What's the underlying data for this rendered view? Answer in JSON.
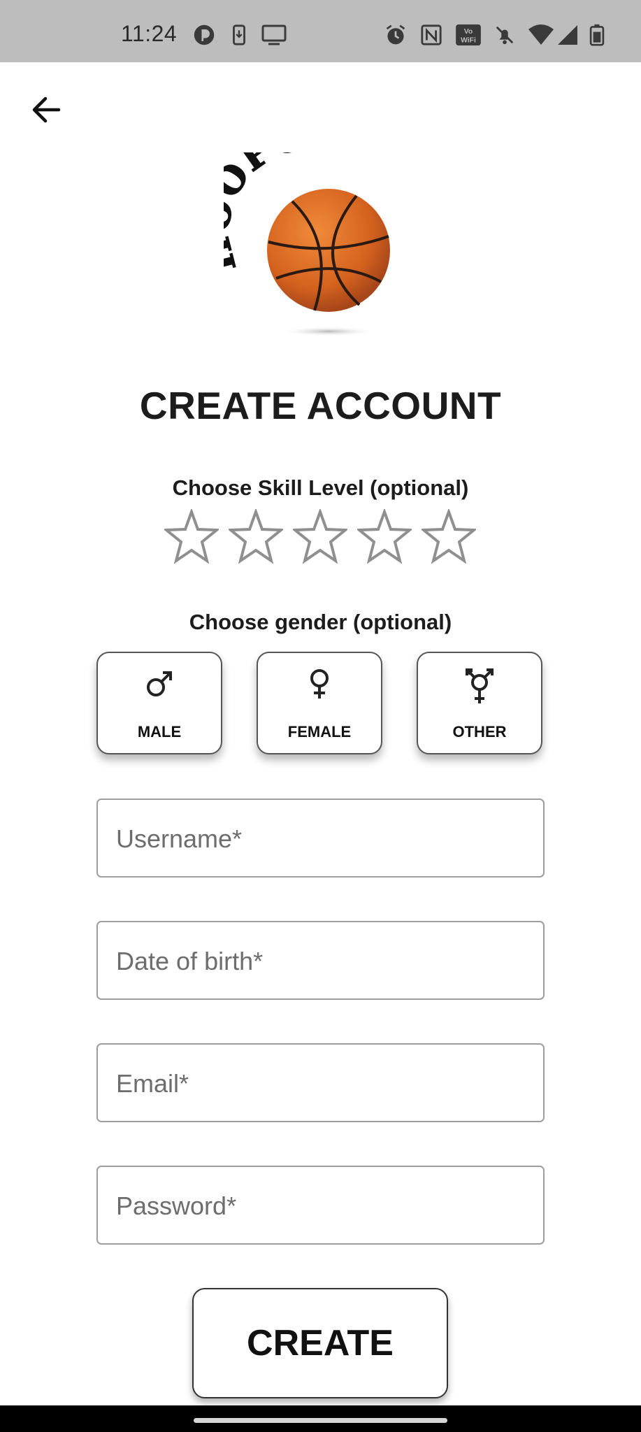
{
  "status_bar": {
    "time": "11:24",
    "icons": [
      "app-badge-icon",
      "download-icon",
      "cast-icon",
      "alarm-icon",
      "nfc-icon",
      "vowifi-icon",
      "mute-icon",
      "wifi-icon",
      "cellular-signal-icon",
      "battery-icon"
    ],
    "vowifi_text": "Vo WiFi"
  },
  "header": {
    "back_icon": "arrow-left-icon"
  },
  "logo": {
    "text": "HOOPUP"
  },
  "page": {
    "title": "CREATE ACCOUNT"
  },
  "skill": {
    "label": "Choose Skill Level (optional)",
    "max_stars": 5,
    "selected": 0
  },
  "gender": {
    "label": "Choose gender (optional)",
    "options": [
      {
        "label": "MALE",
        "icon": "male-symbol-icon"
      },
      {
        "label": "FEMALE",
        "icon": "female-symbol-icon"
      },
      {
        "label": "OTHER",
        "icon": "transgender-symbol-icon"
      }
    ]
  },
  "form": {
    "username_placeholder": "Username*",
    "dob_placeholder": "Date of birth*",
    "email_placeholder": "Email*",
    "password_placeholder": "Password*"
  },
  "actions": {
    "create_label": "CREATE"
  },
  "colors": {
    "status_bar": "#bdbdbd",
    "ball": "#d4621e",
    "star_outline": "#8f8f8f",
    "nav_bar": "#000000"
  }
}
